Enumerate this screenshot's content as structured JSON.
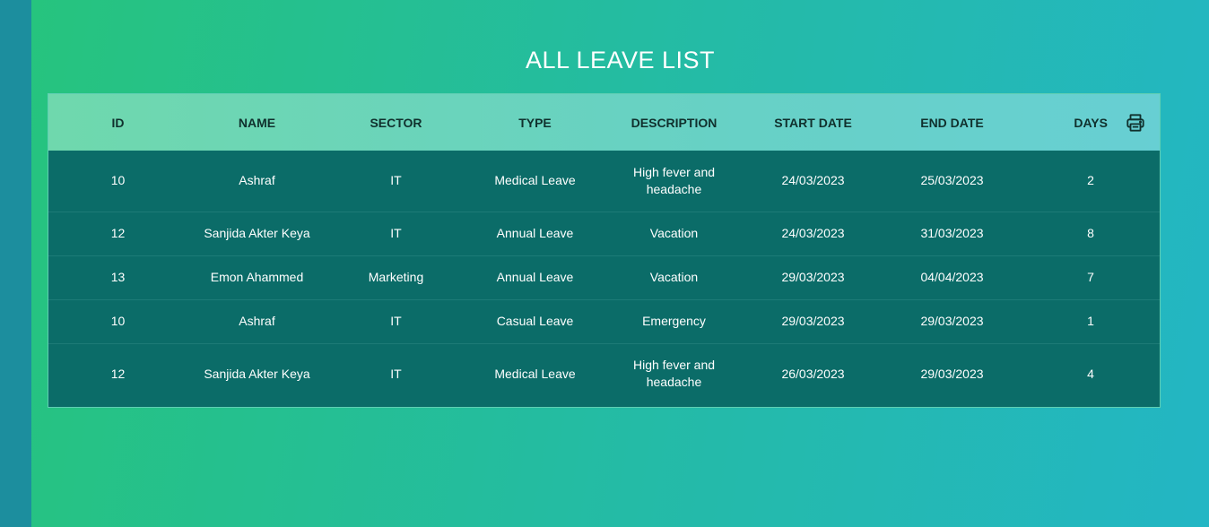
{
  "page": {
    "title": "ALL LEAVE LIST"
  },
  "table": {
    "headers": {
      "id": "ID",
      "name": "NAME",
      "sector": "SECTOR",
      "type": "TYPE",
      "description": "DESCRIPTION",
      "start_date": "START DATE",
      "end_date": "END DATE",
      "days": "DAYS"
    },
    "print_icon": "printer-icon",
    "rows": [
      {
        "id": "10",
        "name": "Ashraf",
        "sector": "IT",
        "type": "Medical Leave",
        "description": "High fever and headache",
        "start_date": "24/03/2023",
        "end_date": "25/03/2023",
        "days": "2"
      },
      {
        "id": "12",
        "name": "Sanjida Akter Keya",
        "sector": "IT",
        "type": "Annual Leave",
        "description": "Vacation",
        "start_date": "24/03/2023",
        "end_date": "31/03/2023",
        "days": "8"
      },
      {
        "id": "13",
        "name": "Emon Ahammed",
        "sector": "Marketing",
        "type": "Annual Leave",
        "description": "Vacation",
        "start_date": "29/03/2023",
        "end_date": "04/04/2023",
        "days": "7"
      },
      {
        "id": "10",
        "name": "Ashraf",
        "sector": "IT",
        "type": "Casual Leave",
        "description": "Emergency",
        "start_date": "29/03/2023",
        "end_date": "29/03/2023",
        "days": "1"
      },
      {
        "id": "12",
        "name": "Sanjida Akter Keya",
        "sector": "IT",
        "type": "Medical Leave",
        "description": "High fever and headache",
        "start_date": "26/03/2023",
        "end_date": "29/03/2023",
        "days": "4"
      }
    ]
  },
  "colors": {
    "background_start": "#26c47c",
    "background_end": "#23b6c4",
    "table_body": "#0b6c68",
    "header_start": "#6fd8ad",
    "header_end": "#67cfd3",
    "sidebar_strip": "#1c8e9e"
  }
}
